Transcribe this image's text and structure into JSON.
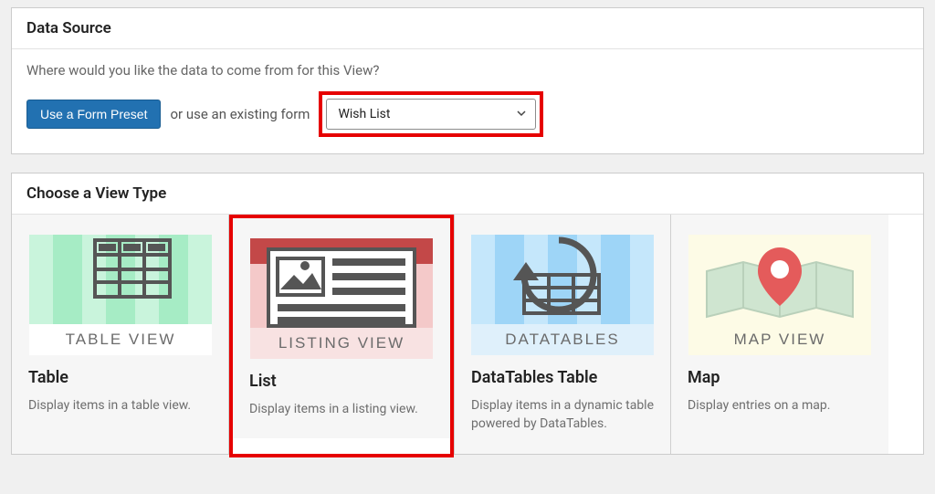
{
  "data_source": {
    "title": "Data Source",
    "prompt": "Where would you like the data to come from for this View?",
    "preset_label": "Use a Form Preset",
    "or_text": "or use an existing form",
    "form_select_value": "Wish List"
  },
  "view_type": {
    "title": "Choose a View Type",
    "cards": [
      {
        "name": "Table",
        "desc": "Display items in a table view.",
        "thumb_label": "TABLE VIEW"
      },
      {
        "name": "List",
        "desc": "Display items in a listing view.",
        "thumb_label": "LISTING VIEW"
      },
      {
        "name": "DataTables Table",
        "desc": "Display items in a dynamic table powered by DataTables.",
        "thumb_label": "DATATABLES"
      },
      {
        "name": "Map",
        "desc": "Display entries on a map.",
        "thumb_label": "MAP VIEW"
      }
    ]
  }
}
